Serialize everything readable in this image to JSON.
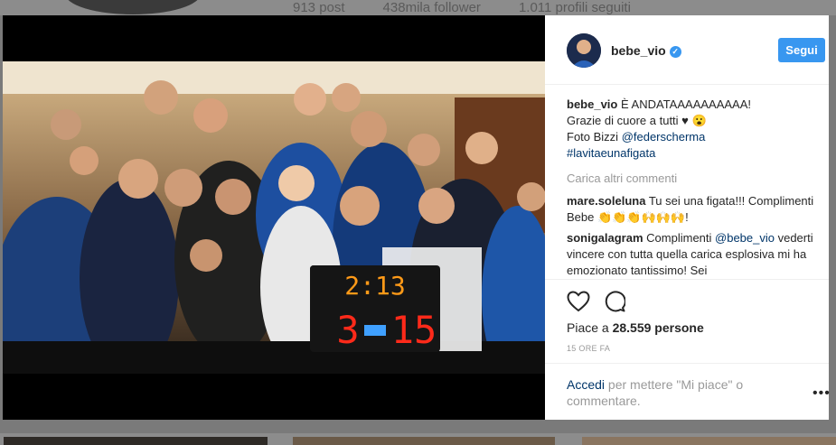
{
  "background": {
    "stats": [
      "913 post",
      "438mila follower",
      "1.011 profili seguiti"
    ]
  },
  "post": {
    "username": "bebe_vio",
    "verified": true,
    "follow_label": "Segui",
    "caption": {
      "user": "bebe_vio",
      "line1": "È ANDATAAAAAAAAAA!",
      "line2": "Grazie di cuore a tutti ♥ 😮",
      "line3_prefix": "Foto Bizzi ",
      "line3_mention": "@federscherma",
      "hashtag": "#lavitaeunafigata"
    },
    "load_more_label": "Carica altri commenti",
    "comments": [
      {
        "user": "mare.soleluna",
        "text": "Tu sei una figata!!! Complimenti Bebe 👏👏👏🙌🙌🙌!"
      },
      {
        "user": "sonigalagram",
        "text_prefix": "Complimenti ",
        "mention": "@bebe_vio",
        "text_suffix": " vederti vincere con tutta quella carica esplosiva mi ha emozionato tantissimo! Sei"
      }
    ],
    "likes_prefix": "Piace a ",
    "likes_count": "28.559 persone",
    "timestamp": "15 ORE FA",
    "login_link": "Accedi",
    "login_text": " per mettere \"Mi piace\" o commentare.",
    "more_icon": "more-options-icon",
    "scoreboard": {
      "time": "2:13",
      "left_score": "3",
      "right_score": "15"
    },
    "colors": {
      "accent": "#3897f0",
      "link": "#003569"
    }
  }
}
